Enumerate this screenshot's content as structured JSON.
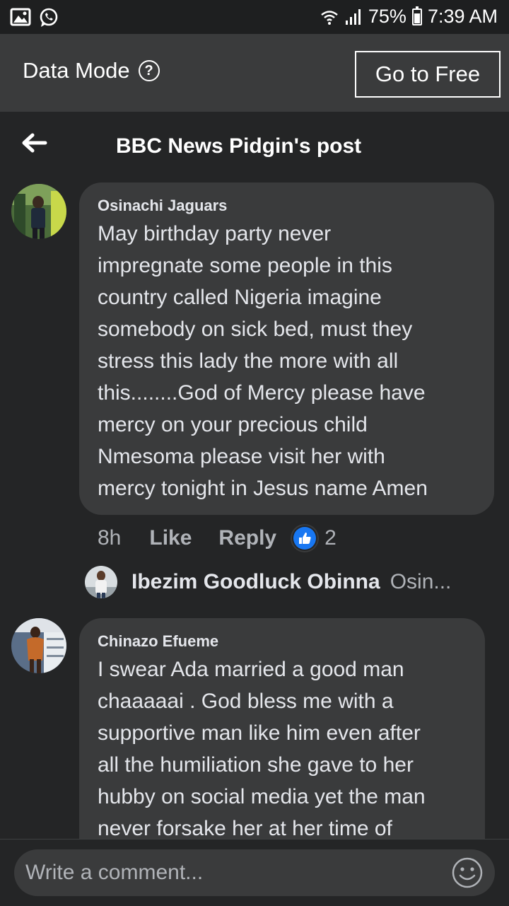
{
  "status_bar": {
    "battery": "75%",
    "time": "7:39 AM",
    "icons": [
      "gallery-icon",
      "whatsapp-icon",
      "wifi-icon",
      "signal-icon",
      "battery-icon"
    ]
  },
  "data_bar": {
    "label": "Data Mode",
    "help_symbol": "?",
    "button": "Go to Free"
  },
  "header": {
    "title": "BBC News Pidgin's post"
  },
  "comments": [
    {
      "author": "Osinachi Jaguars",
      "lines": [
        "May birthday party never",
        "impregnate some people in this",
        "country called Nigeria imagine",
        "somebody on sick bed, must they",
        "stress this lady the more with all",
        "this........God of Mercy please have",
        "mercy on your precious child",
        "Nmesoma please visit her with",
        "mercy tonight in Jesus name Amen"
      ],
      "time": "8h",
      "like_label": "Like",
      "reply_label": "Reply",
      "reaction_count": "2",
      "reply_preview": {
        "name": "Ibezim Goodluck Obinna",
        "text": "Osin..."
      }
    },
    {
      "author": "Chinazo Efueme",
      "lines": [
        "I swear Ada married a good man",
        "chaaaaai . God bless me with a",
        "supportive man like him even after",
        "all the humiliation she gave to her",
        "hubby on social media yet the man",
        "never forsake her at her time of"
      ]
    }
  ],
  "composer": {
    "placeholder": "Write a comment..."
  },
  "colors": {
    "background": "#242526",
    "bubble": "#3a3b3c",
    "data_bar": "#3a3b3c",
    "like_blue": "#1877f2"
  }
}
